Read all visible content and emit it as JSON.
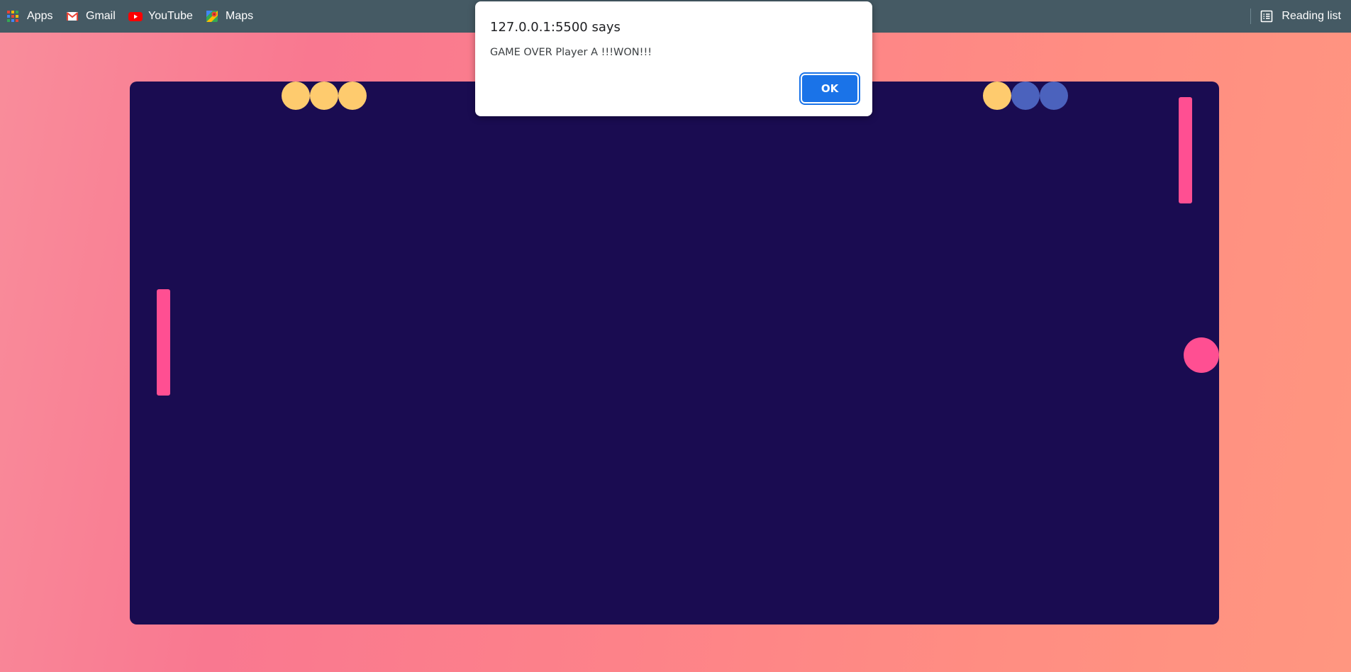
{
  "bookmarks": {
    "items": [
      {
        "label": "Apps",
        "icon": "apps-grid-icon"
      },
      {
        "label": "Gmail",
        "icon": "gmail-icon"
      },
      {
        "label": "YouTube",
        "icon": "youtube-icon"
      },
      {
        "label": "Maps",
        "icon": "maps-icon"
      }
    ],
    "reading_list": {
      "label": "Reading list",
      "icon": "reading-list-icon"
    }
  },
  "dialog": {
    "origin": "127.0.0.1:5500 says",
    "message": "GAME OVER Player A !!!WON!!!",
    "ok_label": "OK"
  },
  "game": {
    "colors": {
      "board": "#1a0c51",
      "paddle": "#ff4f92",
      "ball": "#ff4f92",
      "score_point": "#fecb6e",
      "score_empty": "#4b62bd"
    },
    "player_a_score_dots": [
      "filled",
      "filled",
      "filled"
    ],
    "player_b_score_dots": [
      "filled",
      "empty",
      "empty"
    ]
  }
}
